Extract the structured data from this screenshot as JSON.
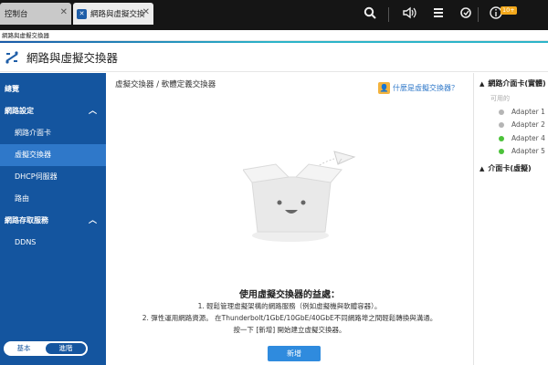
{
  "taskbar": {
    "tabs": [
      {
        "label": "控制台"
      },
      {
        "label": "網路與虛擬交換..."
      }
    ],
    "badge": "10+",
    "icons": [
      "search-icon",
      "volume-icon",
      "stack-icon",
      "sync-icon",
      "info-icon"
    ]
  },
  "window": {
    "breadcrumb": "網路與虛擬交換器",
    "app_title": "網路與虛擬交換器"
  },
  "sidebar": {
    "items": [
      {
        "label": "總覽"
      },
      {
        "label": "網路設定"
      },
      {
        "label": "網路介面卡"
      },
      {
        "label": "虛擬交換器"
      },
      {
        "label": "DHCP伺服器"
      },
      {
        "label": "路由"
      },
      {
        "label": "網路存取服務"
      },
      {
        "label": "DDNS"
      }
    ],
    "mode": {
      "basic": "基本",
      "advanced": "進階"
    }
  },
  "main": {
    "path": "虛擬交換器 / 軟體定義交換器",
    "help_link": "什麼是虛擬交換器？",
    "benefit_title": "使用虛擬交換器的益處：",
    "benefit_lines": [
      "1. 輕鬆管理虛擬架構的網路服務（例如虛擬機與軟體容器）。",
      "2. 彈性運用網路資源。 在Thunderbolt/1GbE/10GbE/40GbE不同網路埠之間輕鬆轉換與溝通。",
      "按一下 [新增] 開始建立虛擬交換器。"
    ],
    "add_button": "新增"
  },
  "right_panel": {
    "section1": "網路介面卡(實體)",
    "available": "可用的",
    "adapters": [
      {
        "label": "Adapter 1",
        "status_color": "#b5b5b5"
      },
      {
        "label": "Adapter 2",
        "status_color": "#b5b5b5"
      },
      {
        "label": "Adapter 4",
        "status_color": "#4cc23a"
      },
      {
        "label": "Adapter 5",
        "status_color": "#4cc23a"
      }
    ],
    "section2": "介面卡(虛擬)"
  }
}
